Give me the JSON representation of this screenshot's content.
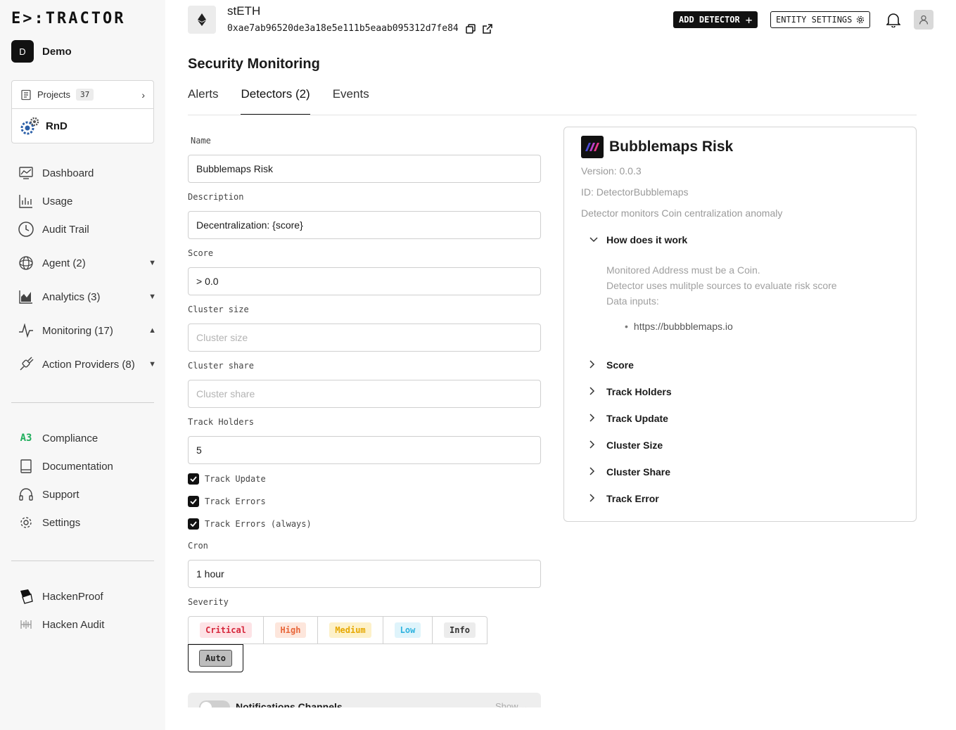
{
  "sidebar": {
    "logo": "E>:TRACTOR",
    "org": {
      "initial": "D",
      "name": "Demo"
    },
    "projects": {
      "label": "Projects",
      "count": "37",
      "current": "RnD"
    },
    "nav": [
      {
        "label": "Dashboard",
        "icon": "dashboard-icon"
      },
      {
        "label": "Usage",
        "icon": "usage-chart-icon"
      },
      {
        "label": "Audit Trail",
        "icon": "clock-icon"
      },
      {
        "label": "Agent (2)",
        "icon": "agent-icon"
      },
      {
        "label": "Analytics (3)",
        "icon": "analytics-icon"
      },
      {
        "label": "Monitoring (17)",
        "icon": "pulse-icon"
      },
      {
        "label": "Action Providers (8)",
        "icon": "plug-icon"
      }
    ],
    "nav2": [
      {
        "label": "Compliance",
        "icon": "compliance-icon"
      },
      {
        "label": "Documentation",
        "icon": "book-icon"
      },
      {
        "label": "Support",
        "icon": "headphones-icon"
      },
      {
        "label": "Settings",
        "icon": "gear-icon"
      }
    ],
    "nav3": [
      {
        "label": "HackenProof",
        "icon": "hackenproof-icon"
      },
      {
        "label": "Hacken Audit",
        "icon": "hacken-audit-icon"
      }
    ]
  },
  "header": {
    "token_name": "stETH",
    "address": "0xae7ab96520de3a18e5e111b5eaab095312d7fe84",
    "add_detector": "ADD DETECTOR",
    "entity_settings": "ENTITY SETTINGS"
  },
  "page": {
    "title": "Security Monitoring",
    "tabs": [
      "Alerts",
      "Detectors (2)",
      "Events"
    ]
  },
  "form": {
    "name_label": "Name",
    "name_value": "Bubblemaps Risk",
    "description_label": "Description",
    "description_value": "Decentralization: {score}",
    "score_label": "Score",
    "score_value": "> 0.0",
    "cluster_size_label": "Cluster size",
    "cluster_size_placeholder": "Cluster size",
    "cluster_share_label": "Cluster share",
    "cluster_share_placeholder": "Cluster share",
    "track_holders_label": "Track Holders",
    "track_holders_value": "5",
    "checks": [
      "Track Update",
      "Track Errors",
      "Track Errors (always)"
    ],
    "cron_label": "Cron",
    "cron_value": "1 hour",
    "severity_label": "Severity",
    "severity": [
      "Critical",
      "High",
      "Medium",
      "Low",
      "Info"
    ],
    "severity_auto": "Auto",
    "notifications_title": "Notifications Channels",
    "notifications_show": "Show"
  },
  "panel": {
    "title": "Bubblemaps Risk",
    "version": "Version: 0.0.3",
    "id": "ID: DetectorBubblemaps",
    "desc": "Detector monitors Coin centralization anomaly",
    "how_title": "How does it work",
    "how_lines": [
      "Monitored Address must be a Coin.",
      "Detector uses mulitple sources to evaluate risk score",
      "Data inputs:"
    ],
    "how_link": "https://bubbblemaps.io",
    "sections": [
      "Score",
      "Track Holders",
      "Track Update",
      "Cluster Size",
      "Cluster Share",
      "Track Error"
    ]
  },
  "colors": {
    "critical_bg": "#fde3e6",
    "critical_fg": "#d6263b",
    "high_bg": "#fde6dc",
    "high_fg": "#e8663a",
    "medium_bg": "#fdf1c9",
    "medium_fg": "#e6a800",
    "low_bg": "#dff4fb",
    "low_fg": "#2fb3df",
    "info_bg": "#ececec",
    "info_fg": "#333333",
    "auto_bg": "#bdbdbd"
  }
}
